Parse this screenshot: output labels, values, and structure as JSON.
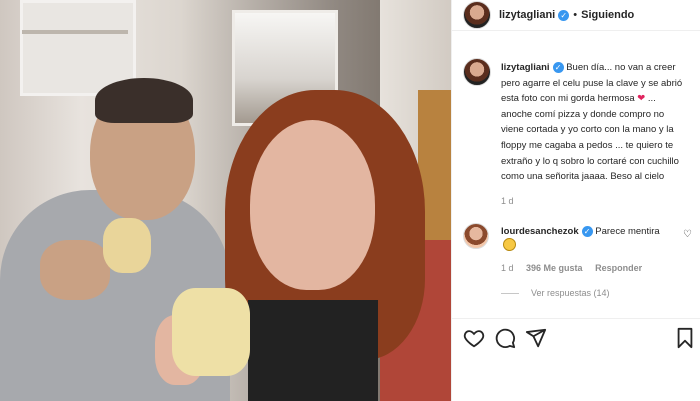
{
  "post": {
    "username": "lizytagliani",
    "follow_status": "Siguiendo",
    "caption_user": "lizytagliani",
    "caption_part1": " Buen día... no van a creer pero agarre el celu puse la clave y se abrió esta foto con mi gorda hermosa ",
    "caption_part2": " ... anoche comí pizza y donde compro no viene cortada y yo corto con la mano y la floppy me cagaba a pedos ... te quiero te extraño y lo q sobro lo cortaré con cuchillo como una señorita jaaaa. Beso al cielo",
    "caption_time": "1 d"
  },
  "comment": {
    "user": "lourdesanchezok",
    "text": " Parece mentira",
    "time": "1 d",
    "likes": "396 Me gusta",
    "reply": "Responder",
    "view_replies": "Ver respuestas (14)"
  },
  "icons": {
    "like": "heart-icon",
    "comment": "comment-icon",
    "share": "share-icon",
    "save": "bookmark-icon"
  }
}
